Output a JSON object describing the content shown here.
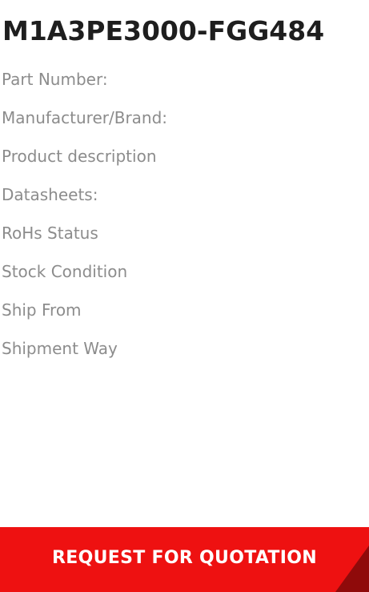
{
  "product": {
    "part_number_title": "M1A3PE3000-FGG484"
  },
  "specs": [
    {
      "label": "Part Number:"
    },
    {
      "label": "Manufacturer/Brand:"
    },
    {
      "label": "Product description"
    },
    {
      "label": "Datasheets:"
    },
    {
      "label": "RoHs Status"
    },
    {
      "label": "Stock Condition"
    },
    {
      "label": "Ship From"
    },
    {
      "label": "Shipment Way"
    }
  ],
  "actions": {
    "rfq_label": "REQUEST FOR QUOTATION"
  },
  "colors": {
    "button_bg": "#ee1111",
    "button_corner": "#8f0a0a",
    "title_text": "#1e1e1e",
    "label_text": "#8c8c8c"
  }
}
